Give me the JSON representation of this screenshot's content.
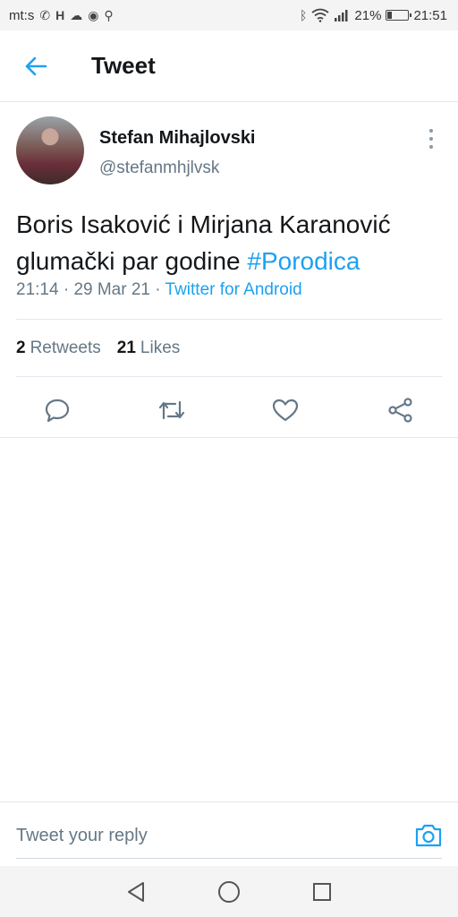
{
  "status_bar": {
    "carrier": "mt:s",
    "battery_percent": "21%",
    "battery_level": 0.21,
    "time": "21:51",
    "icons": [
      "phone-icon",
      "h-icon",
      "cloud-icon",
      "chrome-icon",
      "notification-icon",
      "bluetooth-icon",
      "wifi-icon",
      "signal-icon",
      "battery-icon"
    ]
  },
  "header": {
    "back_icon": "arrow-left-icon",
    "title": "Tweet"
  },
  "tweet": {
    "author_name": "Stefan Mihajlovski",
    "author_handle": "@stefanmhjlvsk",
    "text_before": "Boris Isaković i Mirjana Karanović glumački par godine ",
    "hashtag": "#Porodica",
    "time": "21:14",
    "date": "29 Mar 21",
    "separator": "·",
    "source": "Twitter for Android",
    "retweets_count": "2",
    "retweets_label": "Retweets",
    "likes_count": "21",
    "likes_label": "Likes"
  },
  "actions": [
    "reply-icon",
    "retweet-icon",
    "like-icon",
    "share-icon"
  ],
  "reply_bar": {
    "placeholder": "Tweet your reply"
  },
  "colors": {
    "accent": "#1da1f2",
    "secondary_text": "#657786",
    "primary_text": "#14171a",
    "divider": "#e1e8ed"
  }
}
